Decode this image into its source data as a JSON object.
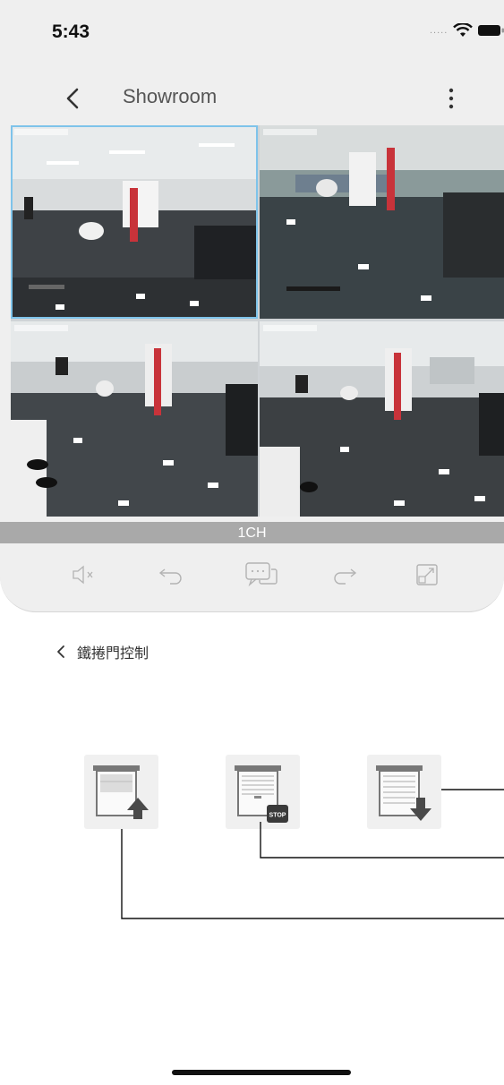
{
  "status_bar": {
    "time": "5:43",
    "signal": "....."
  },
  "nav": {
    "title": "Showroom",
    "back_icon": "chevron-left-icon",
    "more_icon": "vertical-ellipsis-icon"
  },
  "camera_grid": {
    "channel_label": "1CH",
    "tiles": [
      {
        "name": "camera-1",
        "selected": true
      },
      {
        "name": "camera-2",
        "selected": false
      },
      {
        "name": "camera-3",
        "selected": false
      },
      {
        "name": "camera-4",
        "selected": false
      }
    ]
  },
  "controls": [
    "mute-icon",
    "undo-arrow-icon",
    "chat-icon",
    "redo-arrow-icon",
    "expand-icon"
  ],
  "section": {
    "title": "鐵捲門控制"
  },
  "door_buttons": [
    {
      "name": "door-up-button",
      "icon": "door-up-arrow-icon"
    },
    {
      "name": "door-stop-button",
      "icon": "door-stop-icon",
      "badge": "STOP"
    },
    {
      "name": "door-down-button",
      "icon": "door-down-arrow-icon"
    }
  ],
  "colors": {
    "accent_selected": "#7ec3ea",
    "channel_bar": "#a9a9a9",
    "card_bg": "#efefef"
  }
}
